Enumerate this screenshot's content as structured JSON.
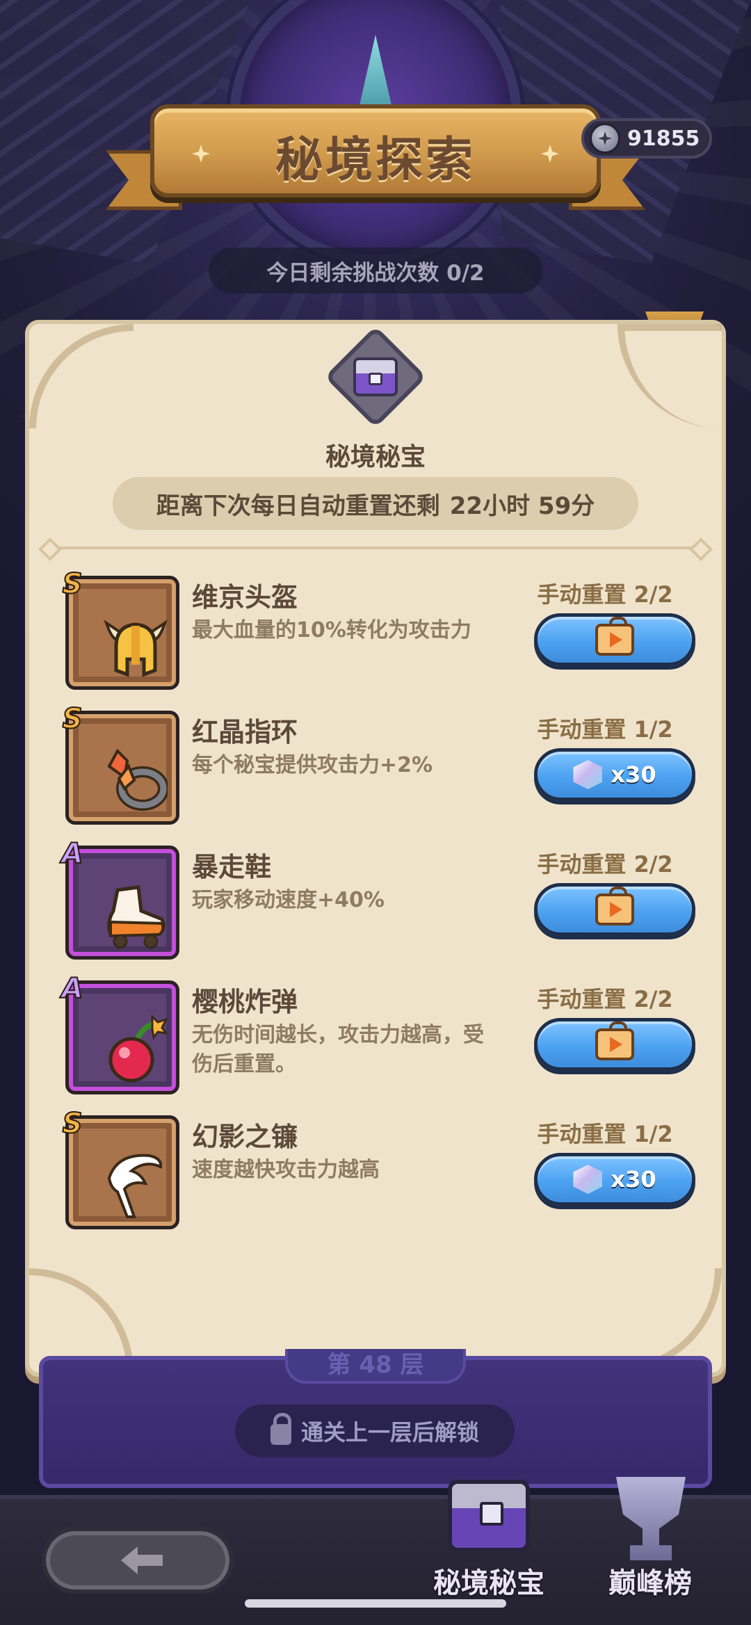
{
  "header": {
    "title": "秘境探索",
    "currency": {
      "icon": "star-coin-icon",
      "value": "91855"
    },
    "daily_attempts": "今日剩余挑战次数 0/2"
  },
  "panel": {
    "title": "秘境秘宝",
    "reset_prefix": "距离下次每日自动重置还剩",
    "reset_time": "22小时 59分"
  },
  "items": [
    {
      "rank": "S",
      "name": "维京头盔",
      "desc": "最大血量的10%转化为攻击力",
      "reset": "手动重置 2/2",
      "button": {
        "type": "video-ad",
        "icon": "tv-play-icon",
        "cost": ""
      }
    },
    {
      "rank": "S",
      "name": "红晶指环",
      "desc": "每个秘宝提供攻击力+2%",
      "reset": "手动重置 1/2",
      "button": {
        "type": "gem",
        "icon": "gem-icon",
        "cost": "x30"
      }
    },
    {
      "rank": "A",
      "name": "暴走鞋",
      "desc": "玩家移动速度+40%",
      "reset": "手动重置 2/2",
      "button": {
        "type": "video-ad",
        "icon": "tv-play-icon",
        "cost": ""
      }
    },
    {
      "rank": "A",
      "name": "樱桃炸弹",
      "desc": "无伤时间越长，攻击力越高，受伤后重置。",
      "reset": "手动重置 2/2",
      "button": {
        "type": "video-ad",
        "icon": "tv-play-icon",
        "cost": ""
      }
    },
    {
      "rank": "S",
      "name": "幻影之镰",
      "desc": "速度越快攻击力越高",
      "reset": "手动重置 1/2",
      "button": {
        "type": "gem",
        "icon": "gem-icon",
        "cost": "x30"
      }
    }
  ],
  "floor": {
    "label": "第 48 层",
    "unlock_text": "通关上一层后解锁"
  },
  "bottom_nav": {
    "tabs": [
      {
        "label": "秘境秘宝",
        "icon": "treasure-chest-icon"
      },
      {
        "label": "巅峰榜",
        "icon": "trophy-icon"
      }
    ]
  },
  "colors": {
    "panel_bg": "#efe3cb",
    "button_blue": "#4da2f1",
    "rank_S": "#f4b446",
    "rank_A": "#c34fda"
  }
}
